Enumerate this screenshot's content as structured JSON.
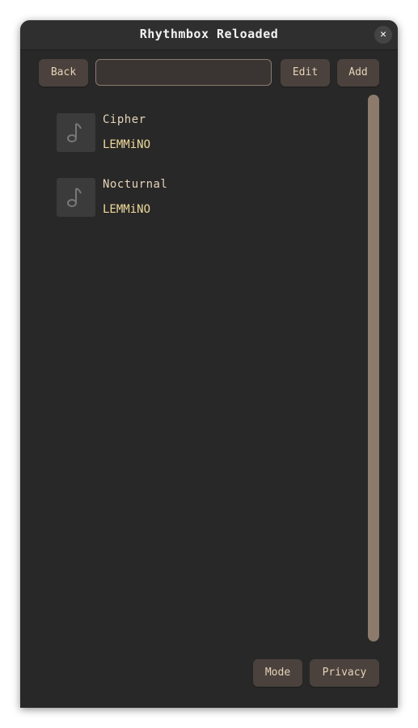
{
  "window": {
    "title": "Rhythmbox Reloaded",
    "close_glyph": "✕"
  },
  "toolbar": {
    "back_label": "Back",
    "search_value": "",
    "edit_label": "Edit",
    "add_label": "Add"
  },
  "tracks": [
    {
      "title": "Cipher",
      "artist": "LEMMiNO",
      "art_icon": "music-note-icon"
    },
    {
      "title": "Nocturnal",
      "artist": "LEMMiNO",
      "art_icon": "music-note-icon"
    }
  ],
  "footer": {
    "mode_label": "Mode",
    "privacy_label": "Privacy"
  },
  "colors": {
    "background": "#282828",
    "button": "#4b423d",
    "button_text": "#e6d3b8",
    "artist_text": "#efd99a",
    "scrollbar": "#8c7b6c"
  }
}
